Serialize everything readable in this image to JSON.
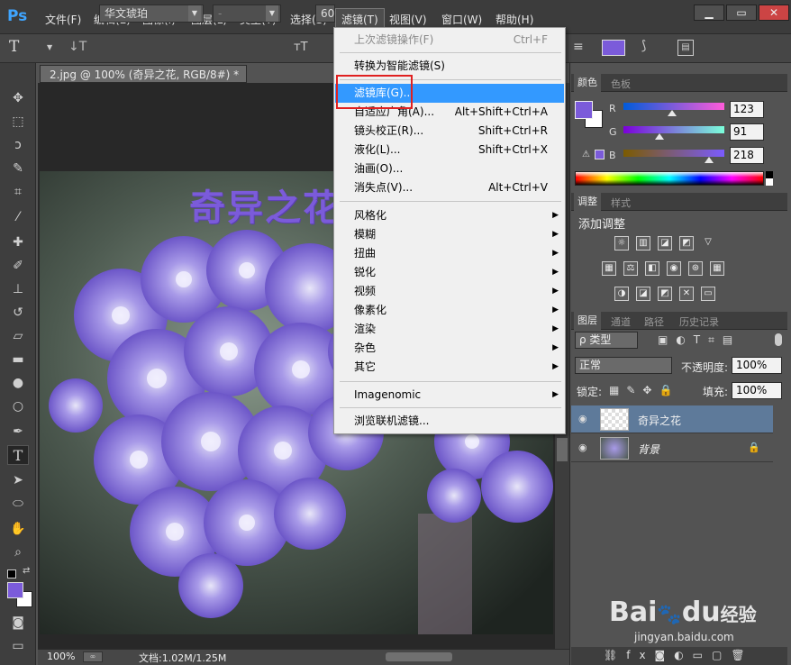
{
  "app": {
    "logo": "Ps"
  },
  "menubar": {
    "items": [
      "文件(F)",
      "编辑(E)",
      "图像(I)",
      "图层(L)",
      "类型(Y)",
      "选择(S)",
      "滤镜(T)",
      "视图(V)",
      "窗口(W)",
      "帮助(H)"
    ],
    "active": "滤镜(T)"
  },
  "window_controls": {
    "minimize": "▁",
    "restore": "▭",
    "close": "✕"
  },
  "options": {
    "tool_glyph": "T",
    "font_family": "华文琥珀",
    "font_style": "-",
    "font_size": "60"
  },
  "document": {
    "tab_title": "2.jpg @ 100% (奇异之花, RGB/8#) *",
    "canvas_text": "奇异之花",
    "zoom": "100%",
    "doc_size": "文档:1.02M/1.25M"
  },
  "filter_menu": {
    "items": [
      {
        "label": "上次滤镜操作(F)",
        "shortcut": "Ctrl+F",
        "disabled": true
      },
      {
        "label": "转换为智能滤镜(S)",
        "shortcut": ""
      },
      {
        "label": "滤镜库(G)...",
        "shortcut": "",
        "highlighted": true
      },
      {
        "label": "自适应广角(A)...",
        "shortcut": "Alt+Shift+Ctrl+A"
      },
      {
        "label": "镜头校正(R)...",
        "shortcut": "Shift+Ctrl+R"
      },
      {
        "label": "液化(L)...",
        "shortcut": "Shift+Ctrl+X"
      },
      {
        "label": "油画(O)...",
        "shortcut": ""
      },
      {
        "label": "消失点(V)...",
        "shortcut": "Alt+Ctrl+V"
      },
      {
        "label": "风格化",
        "submenu": true
      },
      {
        "label": "模糊",
        "submenu": true
      },
      {
        "label": "扭曲",
        "submenu": true
      },
      {
        "label": "锐化",
        "submenu": true
      },
      {
        "label": "视频",
        "submenu": true
      },
      {
        "label": "像素化",
        "submenu": true
      },
      {
        "label": "渲染",
        "submenu": true
      },
      {
        "label": "杂色",
        "submenu": true
      },
      {
        "label": "其它",
        "submenu": true
      },
      {
        "label": "Imagenomic",
        "submenu": true
      },
      {
        "label": "浏览联机滤镜...",
        "shortcut": ""
      }
    ],
    "submenu_arrow": "▶"
  },
  "color_panel": {
    "tabs": [
      "颜色",
      "色板"
    ],
    "r_label": "R",
    "g_label": "G",
    "b_label": "B",
    "r": "123",
    "g": "91",
    "b": "218",
    "foreground": "#7b5bda"
  },
  "adjust_panel": {
    "tabs": [
      "调整",
      "样式"
    ],
    "title": "添加调整"
  },
  "layers_panel": {
    "tabs": [
      "图层",
      "通道",
      "路径",
      "历史记录"
    ],
    "filter_kind": "ρ 类型",
    "blend_mode": "正常",
    "opacity_label": "不透明度:",
    "opacity": "100%",
    "lock_label": "锁定:",
    "fill_label": "填充:",
    "fill": "100%",
    "layers": [
      {
        "name": "奇异之花",
        "selected": true
      },
      {
        "name": "背景",
        "locked": true
      }
    ]
  },
  "watermark": {
    "brand": "Bai",
    "brand2": "du",
    "suffix": "经验",
    "url": "jingyan.baidu.com"
  },
  "colors": {
    "accent_purple": "#7b5bda",
    "highlight": "#3399ff",
    "red_box": "#e02020"
  }
}
